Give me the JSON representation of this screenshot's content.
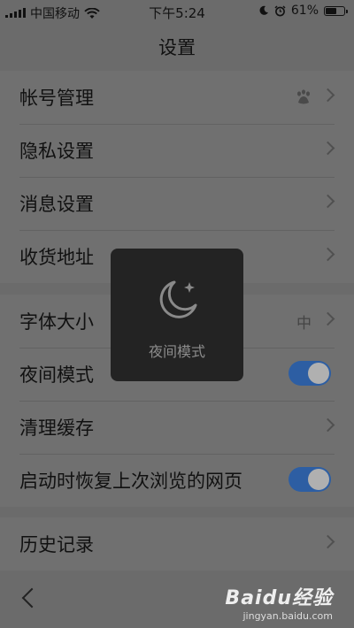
{
  "status_bar": {
    "carrier": "中国移动",
    "time": "下午5:24",
    "battery_percent": "61%",
    "battery_level": 0.61
  },
  "nav": {
    "title": "设置"
  },
  "groups": [
    {
      "rows": [
        {
          "label": "帐号管理",
          "accessory": "chevron",
          "extra_icon": "paw-icon"
        },
        {
          "label": "隐私设置",
          "accessory": "chevron"
        },
        {
          "label": "消息设置",
          "accessory": "chevron"
        },
        {
          "label": "收货地址",
          "accessory": "chevron"
        }
      ]
    },
    {
      "rows": [
        {
          "label": "字体大小",
          "accessory": "chevron",
          "value": "中"
        },
        {
          "label": "夜间模式",
          "accessory": "toggle",
          "on": true
        },
        {
          "label": "清理缓存",
          "accessory": "chevron"
        },
        {
          "label": "启动时恢复上次浏览的网页",
          "accessory": "toggle",
          "on": true
        }
      ]
    },
    {
      "rows": [
        {
          "label": "历史记录",
          "accessory": "chevron"
        }
      ]
    }
  ],
  "toast": {
    "label": "夜间模式",
    "icon": "moon-sparkle-icon"
  },
  "bottom_bar": {
    "back_icon": "chevron-left-icon"
  },
  "watermark": {
    "main": "Baidu经验",
    "sub": "jingyan.baidu.com"
  },
  "colors": {
    "toggle_on": "#2d5ea3",
    "overlay_bg": "#6b6b6b",
    "toast_bg": "#232323"
  }
}
